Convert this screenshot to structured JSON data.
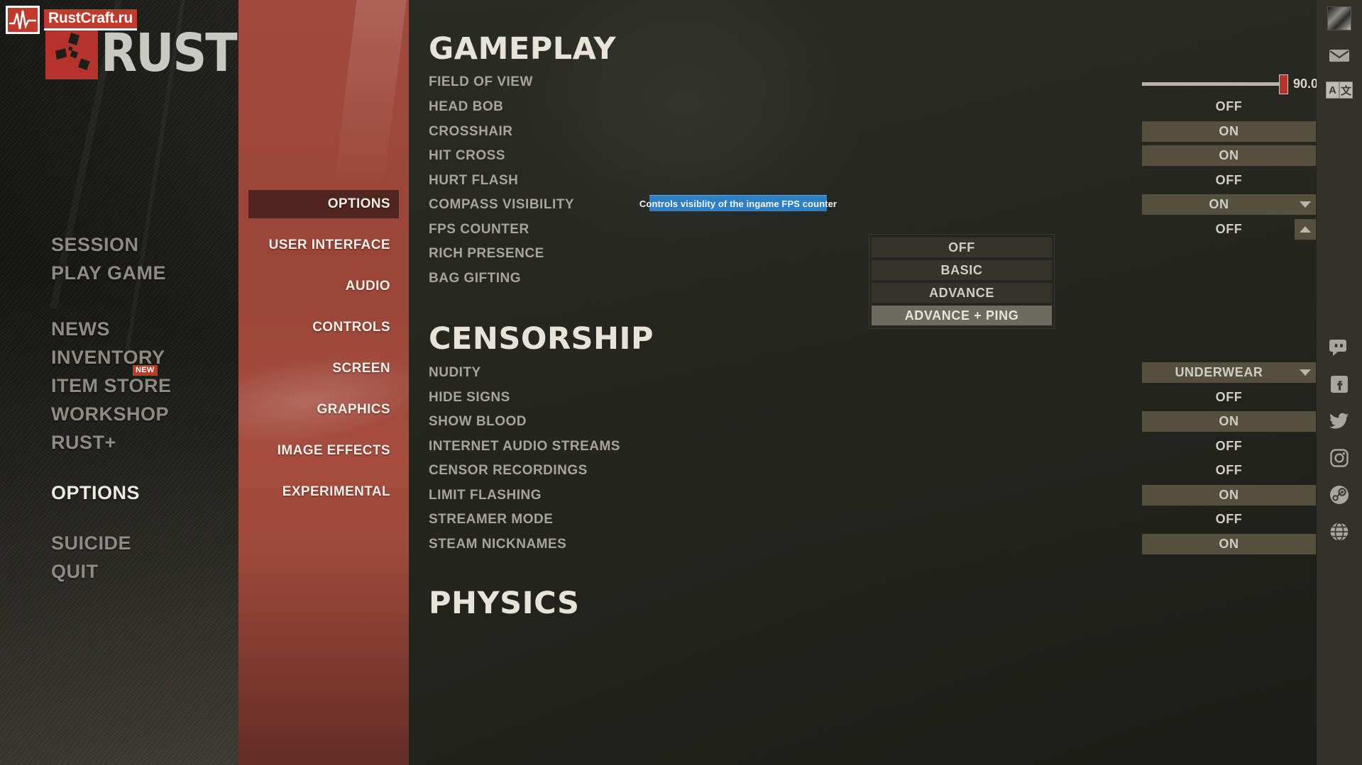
{
  "branding": {
    "watermark_text": "RustCraft.ru",
    "watermark_icon": "ecg-heartbeat-icon",
    "game_title": "RUST"
  },
  "sidebar": {
    "groups": [
      {
        "items": [
          {
            "label": "SESSION",
            "active": false
          },
          {
            "label": "PLAY GAME",
            "active": false
          }
        ]
      },
      {
        "items": [
          {
            "label": "NEWS",
            "active": false
          },
          {
            "label": "INVENTORY",
            "active": false
          },
          {
            "label": "ITEM STORE",
            "active": false,
            "badge": "NEW"
          },
          {
            "label": "WORKSHOP",
            "active": false
          },
          {
            "label": "RUST+",
            "active": false
          }
        ]
      },
      {
        "items": [
          {
            "label": "OPTIONS",
            "active": true
          }
        ]
      },
      {
        "items": [
          {
            "label": "SUICIDE",
            "active": false
          },
          {
            "label": "QUIT",
            "active": false
          }
        ]
      }
    ]
  },
  "categories": [
    {
      "label": "OPTIONS",
      "active": true
    },
    {
      "label": "USER INTERFACE",
      "active": false
    },
    {
      "label": "AUDIO",
      "active": false
    },
    {
      "label": "CONTROLS",
      "active": false
    },
    {
      "label": "SCREEN",
      "active": false
    },
    {
      "label": "GRAPHICS",
      "active": false
    },
    {
      "label": "IMAGE EFFECTS",
      "active": false
    },
    {
      "label": "EXPERIMENTAL",
      "active": false
    }
  ],
  "sections": [
    {
      "title": "GAMEPLAY",
      "rows": [
        {
          "label": "FIELD OF VIEW",
          "type": "slider",
          "value": "90.0",
          "percent": 97
        },
        {
          "label": "HEAD BOB",
          "type": "toggle",
          "value": "OFF"
        },
        {
          "label": "CROSSHAIR",
          "type": "toggle",
          "value": "ON"
        },
        {
          "label": "HIT CROSS",
          "type": "toggle",
          "value": "ON"
        },
        {
          "label": "HURT FLASH",
          "type": "toggle",
          "value": "OFF"
        },
        {
          "label": "COMPASS VISIBILITY",
          "type": "select",
          "value": "ON",
          "chevron": "down"
        },
        {
          "label": "FPS COUNTER",
          "type": "select",
          "value": "OFF",
          "chevron": "up"
        },
        {
          "label": "RICH PRESENCE",
          "type": "toggle",
          "value": ""
        },
        {
          "label": "BAG GIFTING",
          "type": "toggle",
          "value": ""
        }
      ]
    },
    {
      "title": "CENSORSHIP",
      "rows": [
        {
          "label": "NUDITY",
          "type": "select",
          "value": "UNDERWEAR",
          "chevron": "down"
        },
        {
          "label": "HIDE SIGNS",
          "type": "toggle",
          "value": "OFF"
        },
        {
          "label": "SHOW BLOOD",
          "type": "toggle",
          "value": "ON"
        },
        {
          "label": "INTERNET AUDIO STREAMS",
          "type": "toggle",
          "value": "OFF"
        },
        {
          "label": "CENSOR RECORDINGS",
          "type": "toggle",
          "value": "OFF"
        },
        {
          "label": "LIMIT FLASHING",
          "type": "toggle",
          "value": "ON"
        },
        {
          "label": "STREAMER MODE",
          "type": "toggle",
          "value": "OFF"
        },
        {
          "label": "STEAM NICKNAMES",
          "type": "toggle",
          "value": "ON"
        }
      ]
    },
    {
      "title": "PHYSICS",
      "rows": []
    }
  ],
  "tooltip": {
    "text": "Controls visiblity of the ingame FPS counter"
  },
  "dropdown": {
    "open_for": "FPS COUNTER",
    "options": [
      {
        "label": "OFF",
        "hovered": false
      },
      {
        "label": "BASIC",
        "hovered": false
      },
      {
        "label": "ADVANCE",
        "hovered": false
      },
      {
        "label": "ADVANCE + PING",
        "hovered": true
      }
    ]
  },
  "rail": {
    "avatar": "player-avatar",
    "lang": {
      "left": "A",
      "right": "文"
    },
    "icons": [
      "mail-icon",
      "discord-icon",
      "facebook-icon",
      "twitter-icon",
      "instagram-icon",
      "steam-icon",
      "globe-icon"
    ]
  },
  "colors": {
    "accent_red": "#b5332a",
    "panel_red": "#9a4538",
    "toggle_on": "#55503e",
    "tooltip_blue": "#2f7fc4",
    "text_primary": "#e8e3d9",
    "text_muted": "#a6a49c"
  }
}
